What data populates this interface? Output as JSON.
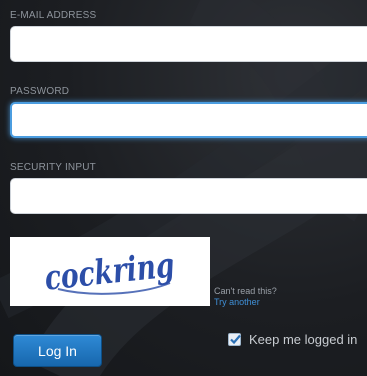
{
  "email": {
    "label": "E-MAIL ADDRESS",
    "value": "",
    "placeholder": ""
  },
  "password": {
    "label": "PASSWORD",
    "value": "",
    "placeholder": ""
  },
  "security": {
    "label": "SECURITY INPUT",
    "value": "",
    "placeholder": ""
  },
  "captcha": {
    "text": "cockring",
    "cant_read": "Can't read this?",
    "try_another": "Try another"
  },
  "login_button": "Log In",
  "keep_logged_in": {
    "label": "Keep me logged in",
    "checked": true
  },
  "colors": {
    "accent": "#2f8ad6",
    "link": "#3f8fd6",
    "captcha_ink": "#2c4ea8"
  }
}
